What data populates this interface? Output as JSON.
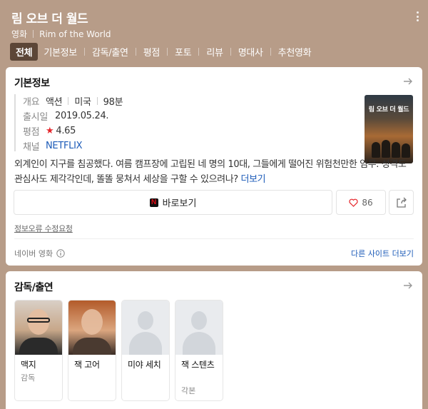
{
  "header": {
    "title": "림 오브 더 월드",
    "category": "영화",
    "original_title": "Rim of the World",
    "more_icon": "vertical-dots-icon"
  },
  "tabs": [
    {
      "label": "전체",
      "active": true
    },
    {
      "label": "기본정보",
      "active": false
    },
    {
      "label": "감독/출연",
      "active": false
    },
    {
      "label": "평점",
      "active": false
    },
    {
      "label": "포토",
      "active": false
    },
    {
      "label": "리뷰",
      "active": false
    },
    {
      "label": "명대사",
      "active": false
    },
    {
      "label": "추천영화",
      "active": false
    }
  ],
  "basic_info": {
    "title": "기본정보",
    "rows": {
      "overview": {
        "label": "개요",
        "genre": "액션",
        "country": "미국",
        "runtime": "98분"
      },
      "release": {
        "label": "출시일",
        "value": "2019.05.24."
      },
      "rating": {
        "label": "평점",
        "value": "4.65"
      },
      "channel": {
        "label": "채널",
        "value": "NETFLIX"
      }
    },
    "poster_title": "림 오브 더 월드",
    "description": "외계인이 지구를 침공했다. 여름 캠프장에 고립된 네 명의 10대, 그들에게 떨어진 위험천만한 임무. 성격도 관심사도 제각각인데, 똘똘 뭉쳐서 세상을 구할 수 있으려나?",
    "more_label": "더보기",
    "watch_label": "바로보기",
    "like_count": "86",
    "report_label": "정보오류 수정요청",
    "source_label": "네이버 영화",
    "other_sites_label": "다른 사이트 더보기"
  },
  "cast": {
    "title": "감독/출연",
    "people": [
      {
        "name": "맥지",
        "role": "감독",
        "photo": "real1"
      },
      {
        "name": "잭 고어",
        "role": "",
        "photo": "real2"
      },
      {
        "name": "미야 세치",
        "role": "",
        "photo": "blank"
      },
      {
        "name": "잭 스텐츠",
        "role": "각본",
        "photo": "blank"
      }
    ]
  },
  "colors": {
    "header_bg": "#b79c88",
    "active_tab": "#5c4637",
    "link": "#1c5bb8",
    "star": "#e5262b",
    "netflix": "#e50914"
  }
}
